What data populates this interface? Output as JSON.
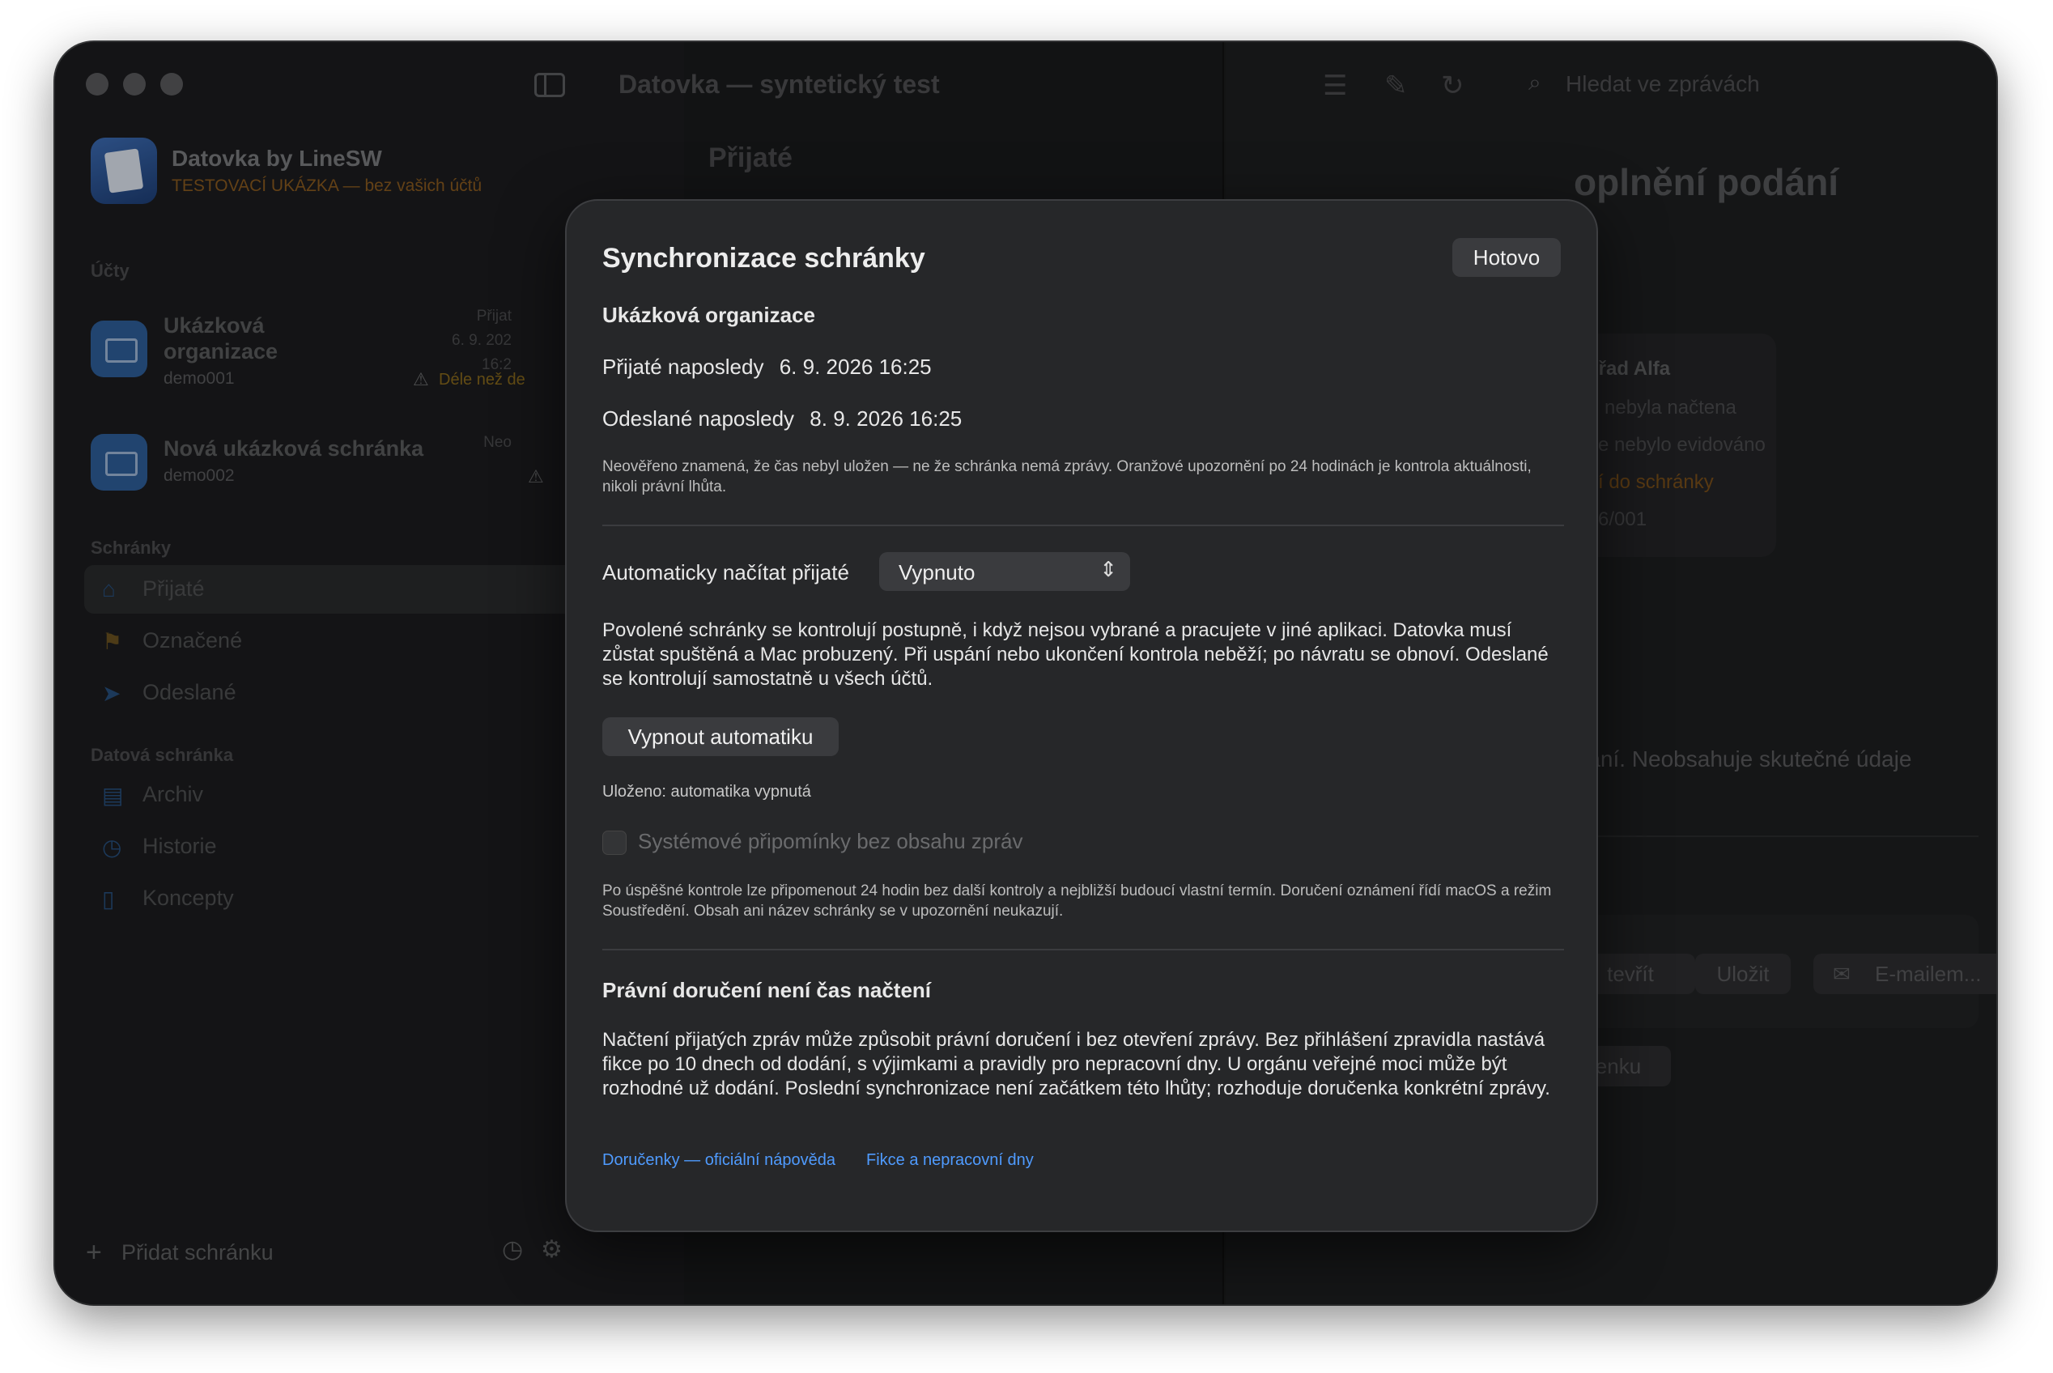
{
  "window": {
    "title": "Datovka — syntetický test"
  },
  "app": {
    "name": "Datovka by LineSW",
    "subtitle": "TESTOVACÍ UKÁZKA — bez vašich účtů"
  },
  "sidebar": {
    "accounts_header": "Účty",
    "accounts": [
      {
        "name": "Ukázková organizace",
        "id": "demo001",
        "meta": [
          "Přijat",
          "6. 9. 202",
          "16:2"
        ],
        "warning": "Déle než de"
      },
      {
        "name": "Nová ukázková schránka",
        "id": "demo002",
        "meta": [
          "Neo"
        ]
      }
    ],
    "boxes_header": "Schránky",
    "boxes": [
      {
        "label": "Přijaté",
        "icon": "inbox-icon"
      },
      {
        "label": "Označené",
        "icon": "flag-icon"
      },
      {
        "label": "Odeslané",
        "icon": "paper-plane-icon"
      }
    ],
    "databox_header": "Datová schránka",
    "databox": [
      {
        "label": "Archiv",
        "icon": "archive-icon"
      },
      {
        "label": "Historie",
        "icon": "history-icon"
      },
      {
        "label": "Koncepty",
        "icon": "document-icon"
      }
    ],
    "add_label": "Přidat schránku"
  },
  "middle": {
    "title": "Přijaté"
  },
  "toolbar": {
    "search_placeholder": "Hledat ve zprávách"
  },
  "detail": {
    "title_fragment": "oplnění podání",
    "card_lines": [
      "úřad Alfa",
      "nebyla načtena",
      "e nebylo evidováno",
      "í do schránky",
      "6/001"
    ],
    "notice": "raní. Neobsahuje skutečné údaje",
    "buttons": [
      "tevřít",
      "Uložit",
      "E-mailem..."
    ],
    "button_more": "enku"
  },
  "modal": {
    "title": "Synchronizace schránky",
    "done": "Hotovo",
    "org": "Ukázková organizace",
    "received_label": "Přijaté naposledy",
    "received_value": "6. 9. 2026 16:25",
    "sent_label": "Odeslané naposledy",
    "sent_value": "8. 9. 2026 16:25",
    "note1": "Neověřeno znamená, že čas nebyl uložen — ne že schránka nemá zprávy. Oranžové upozornění po 24 hodinách je kontrola aktuálnosti, nikoli právní lhůta.",
    "auto_label": "Automaticky načítat přijaté",
    "auto_value": "Vypnuto",
    "auto_desc": "Povolené schránky se kontrolují postupně, i když nejsou vybrané a pracujete v jiné aplikaci. Datovka musí zůstat spuštěná a Mac probuzený. Při uspání nebo ukončení kontrola neběží; po návratu se obnoví. Odeslané se kontrolují samostatně u všech účtů.",
    "disable_btn": "Vypnout automatiku",
    "saved": "Uloženo: automatika vypnutá",
    "reminders_label": "Systémové připomínky bez obsahu zpráv",
    "reminders_desc": "Po úspěšné kontrole lze připomenout 24 hodin bez další kontroly a nejbližší budoucí vlastní termín. Doručení oznámení řídí macOS a režim Soustředění. Obsah ani název schránky se v upozornění neukazují.",
    "legal_title": "Právní doručení není čas načtení",
    "legal_desc": "Načtení přijatých zpráv může způsobit právní doručení i bez otevření zprávy. Bez přihlášení zpravidla nastává fikce po 10 dnech od dodání, s výjimkami a pravidly pro nepracovní dny. U orgánu veřejné moci může být rozhodné už dodání. Poslední synchronizace není začátkem této lhůty; rozhoduje doručenka konkrétní zprávy.",
    "link1": "Doručenky — oficiální nápověda",
    "link2": "Fikce a nepracovní dny"
  }
}
